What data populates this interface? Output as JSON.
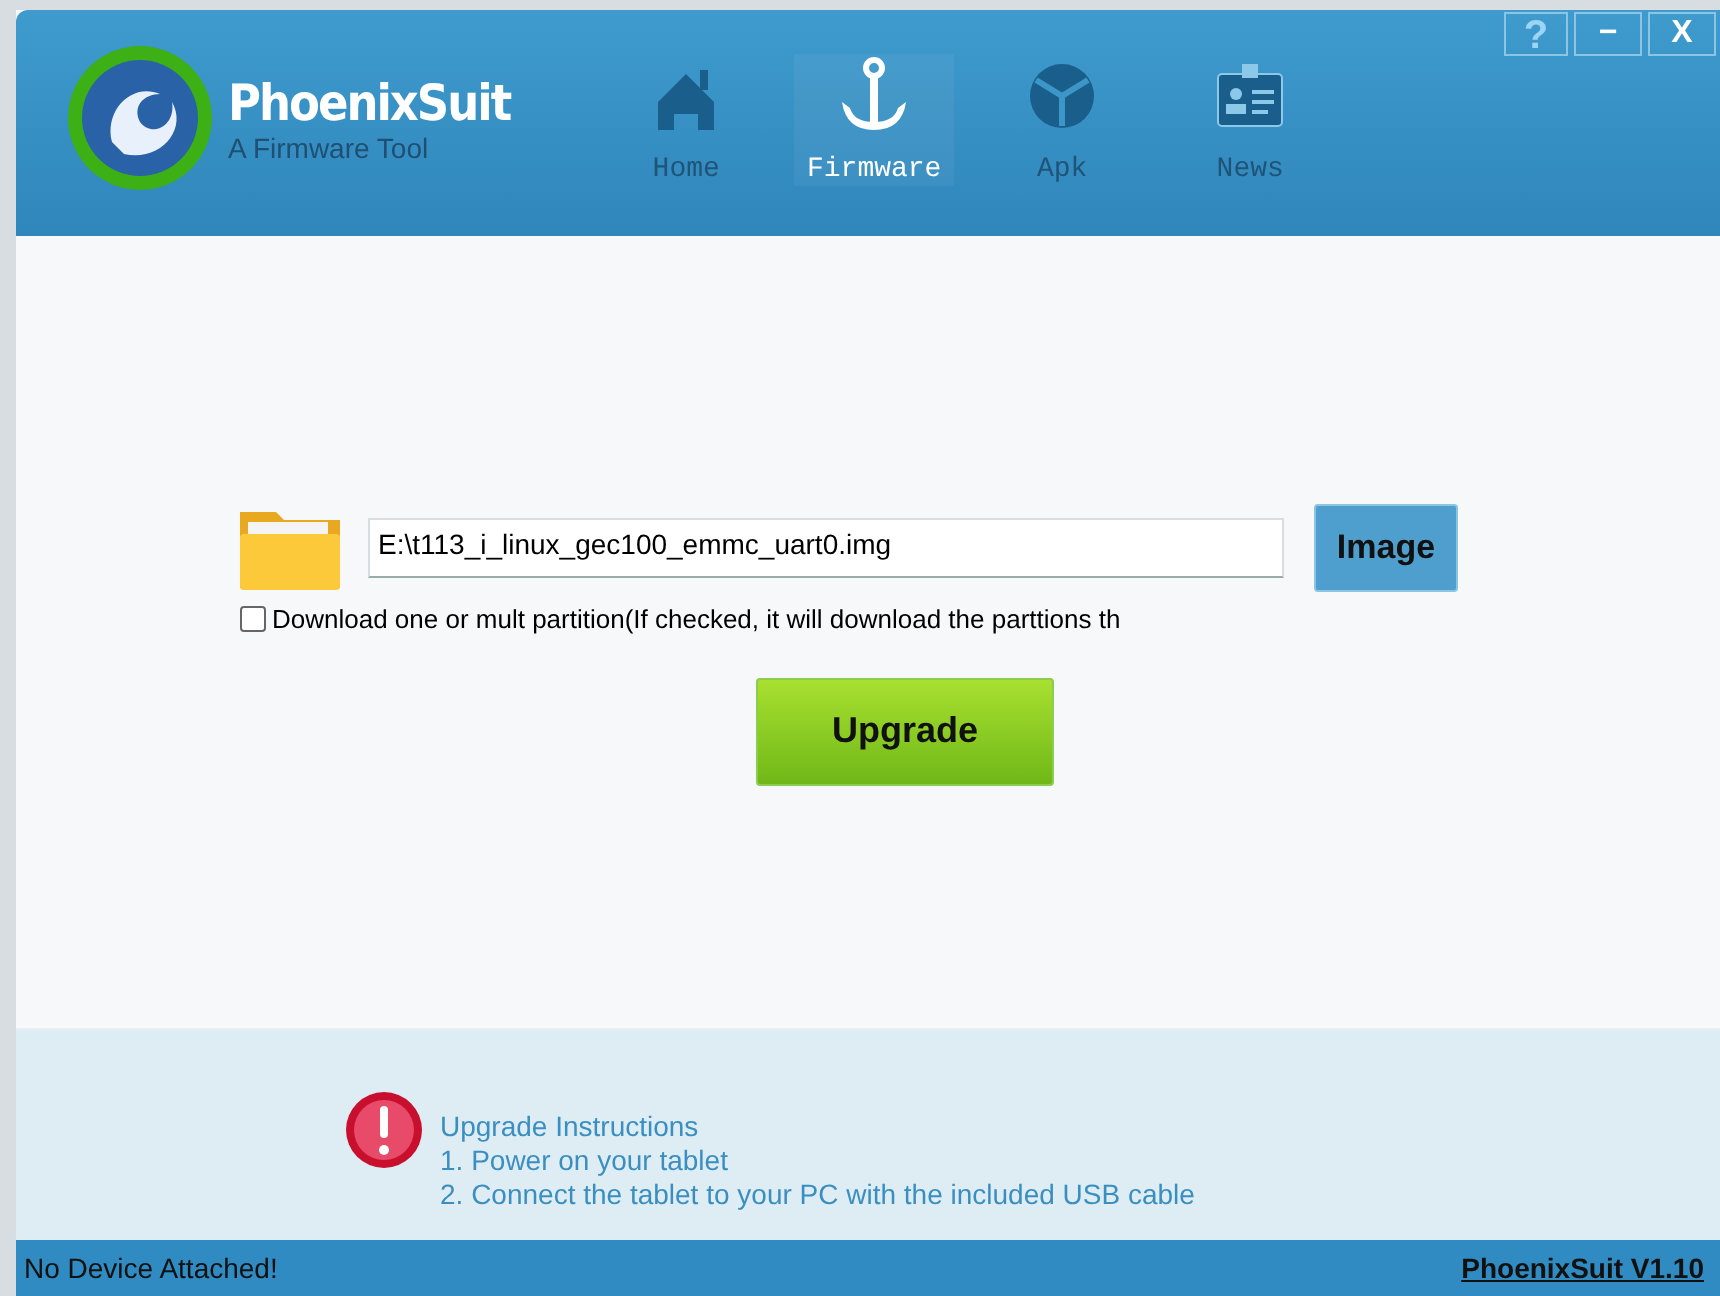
{
  "app": {
    "name": "PhoenixSuit",
    "tagline": "A Firmware Tool"
  },
  "window_buttons": [
    {
      "kind": "help",
      "label": "?"
    },
    {
      "kind": "minimize",
      "label": "−"
    },
    {
      "kind": "close",
      "label": "X"
    }
  ],
  "tabs": [
    {
      "kind": "home",
      "label": "Home",
      "selected": false
    },
    {
      "kind": "firmware",
      "label": "Firmware",
      "selected": true
    },
    {
      "kind": "apk",
      "label": "Apk",
      "selected": false
    },
    {
      "kind": "news",
      "label": "News",
      "selected": false
    }
  ],
  "firmware": {
    "path": "E:\\t113_i_linux_gec100_emmc_uart0.img",
    "image_button": "Image",
    "partition_checkbox": {
      "label": "Download one or mult partition(If checked, it will download the parttions th",
      "checked": false
    },
    "upgrade_button": "Upgrade"
  },
  "instructions": {
    "title": "Upgrade Instructions",
    "lines": [
      "1. Power on your tablet",
      "2. Connect the tablet to your PC with the included USB cable"
    ]
  },
  "status_bar": {
    "status": "No Device Attached!",
    "version": "PhoenixSuit V1.10"
  }
}
